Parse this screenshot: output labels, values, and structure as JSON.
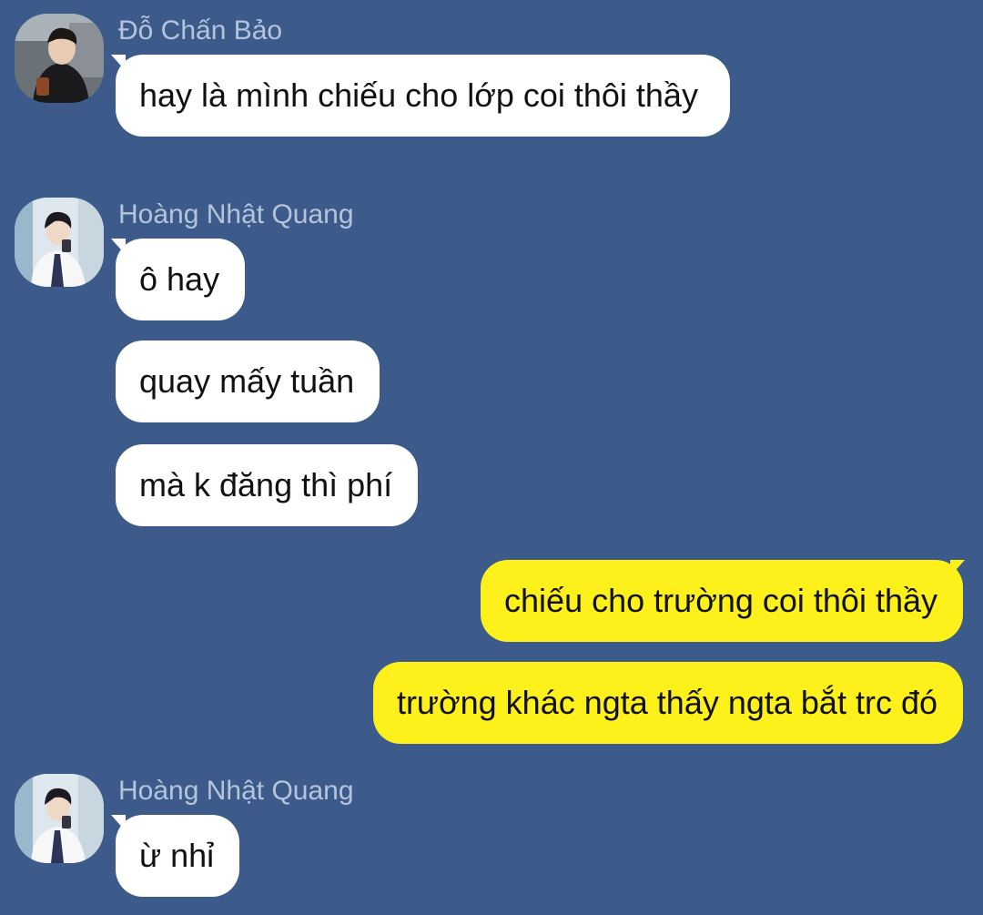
{
  "messages": [
    {
      "sender": "Đỗ Chấn Bảo",
      "avatar_icon": "user-avatar-photo",
      "texts": [
        "hay là mình chiếu cho lớp coi thôi thầy"
      ]
    },
    {
      "sender": "Hoàng Nhật Quang",
      "avatar_icon": "user-avatar-photo",
      "texts": [
        "ô hay",
        "quay mấy tuần",
        "mà k đăng thì phí"
      ]
    },
    {
      "sender": "me",
      "texts": [
        "chiếu cho trường coi thôi thầy",
        "trường khác ngta thấy ngta bắt trc đó"
      ]
    },
    {
      "sender": "Hoàng Nhật Quang",
      "avatar_icon": "user-avatar-photo",
      "texts": [
        "ừ nhỉ"
      ]
    }
  ],
  "colors": {
    "background": "#3d5b8a",
    "incoming_bubble": "#ffffff",
    "outgoing_bubble": "#fef01b",
    "sender_name": "#b4c4dc"
  }
}
